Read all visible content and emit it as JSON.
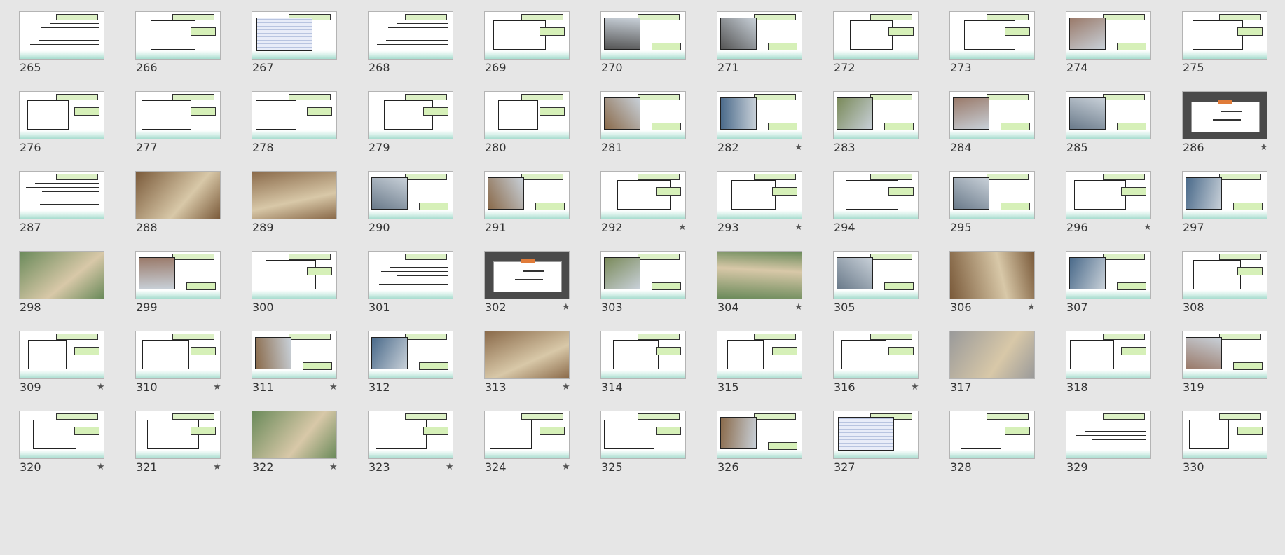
{
  "grid": {
    "columns": 11,
    "slides": [
      {
        "number": "265",
        "starred": false,
        "kind": "text"
      },
      {
        "number": "266",
        "starred": false,
        "kind": "diagram"
      },
      {
        "number": "267",
        "starred": false,
        "kind": "table"
      },
      {
        "number": "268",
        "starred": false,
        "kind": "text"
      },
      {
        "number": "269",
        "starred": false,
        "kind": "diagram"
      },
      {
        "number": "270",
        "starred": false,
        "kind": "photo-grey"
      },
      {
        "number": "271",
        "starred": false,
        "kind": "photo-grey"
      },
      {
        "number": "272",
        "starred": false,
        "kind": "diagram"
      },
      {
        "number": "273",
        "starred": false,
        "kind": "diagram"
      },
      {
        "number": "274",
        "starred": false,
        "kind": "photo"
      },
      {
        "number": "275",
        "starred": false,
        "kind": "diagram"
      },
      {
        "number": "276",
        "starred": false,
        "kind": "diagram"
      },
      {
        "number": "277",
        "starred": false,
        "kind": "diagram"
      },
      {
        "number": "278",
        "starred": false,
        "kind": "diagram"
      },
      {
        "number": "279",
        "starred": false,
        "kind": "diagram"
      },
      {
        "number": "280",
        "starred": false,
        "kind": "diagram"
      },
      {
        "number": "281",
        "starred": false,
        "kind": "photo"
      },
      {
        "number": "282",
        "starred": true,
        "kind": "photo"
      },
      {
        "number": "283",
        "starred": false,
        "kind": "photo"
      },
      {
        "number": "284",
        "starred": false,
        "kind": "photo"
      },
      {
        "number": "285",
        "starred": false,
        "kind": "photo"
      },
      {
        "number": "286",
        "starred": true,
        "kind": "title"
      },
      {
        "number": "287",
        "starred": false,
        "kind": "text"
      },
      {
        "number": "288",
        "starred": false,
        "kind": "photo-full"
      },
      {
        "number": "289",
        "starred": false,
        "kind": "photo-full"
      },
      {
        "number": "290",
        "starred": false,
        "kind": "photo"
      },
      {
        "number": "291",
        "starred": false,
        "kind": "photo"
      },
      {
        "number": "292",
        "starred": true,
        "kind": "diagram"
      },
      {
        "number": "293",
        "starred": true,
        "kind": "diagram"
      },
      {
        "number": "294",
        "starred": false,
        "kind": "diagram"
      },
      {
        "number": "295",
        "starred": false,
        "kind": "photo"
      },
      {
        "number": "296",
        "starred": true,
        "kind": "diagram"
      },
      {
        "number": "297",
        "starred": false,
        "kind": "photo"
      },
      {
        "number": "298",
        "starred": false,
        "kind": "photo-full"
      },
      {
        "number": "299",
        "starred": false,
        "kind": "photo"
      },
      {
        "number": "300",
        "starred": false,
        "kind": "diagram"
      },
      {
        "number": "301",
        "starred": false,
        "kind": "text"
      },
      {
        "number": "302",
        "starred": true,
        "kind": "title"
      },
      {
        "number": "303",
        "starred": false,
        "kind": "photo"
      },
      {
        "number": "304",
        "starred": true,
        "kind": "photo-full"
      },
      {
        "number": "305",
        "starred": false,
        "kind": "photo"
      },
      {
        "number": "306",
        "starred": true,
        "kind": "photo-full"
      },
      {
        "number": "307",
        "starred": false,
        "kind": "photo"
      },
      {
        "number": "308",
        "starred": false,
        "kind": "diagram"
      },
      {
        "number": "309",
        "starred": true,
        "kind": "diagram"
      },
      {
        "number": "310",
        "starred": true,
        "kind": "diagram"
      },
      {
        "number": "311",
        "starred": true,
        "kind": "photo"
      },
      {
        "number": "312",
        "starred": false,
        "kind": "photo"
      },
      {
        "number": "313",
        "starred": true,
        "kind": "photo-full"
      },
      {
        "number": "314",
        "starred": false,
        "kind": "diagram"
      },
      {
        "number": "315",
        "starred": false,
        "kind": "diagram"
      },
      {
        "number": "316",
        "starred": true,
        "kind": "diagram"
      },
      {
        "number": "317",
        "starred": false,
        "kind": "photo-full"
      },
      {
        "number": "318",
        "starred": false,
        "kind": "diagram"
      },
      {
        "number": "319",
        "starred": false,
        "kind": "photo"
      },
      {
        "number": "320",
        "starred": true,
        "kind": "diagram"
      },
      {
        "number": "321",
        "starred": true,
        "kind": "diagram"
      },
      {
        "number": "322",
        "starred": true,
        "kind": "photo-full"
      },
      {
        "number": "323",
        "starred": true,
        "kind": "diagram"
      },
      {
        "number": "324",
        "starred": true,
        "kind": "diagram"
      },
      {
        "number": "325",
        "starred": false,
        "kind": "diagram"
      },
      {
        "number": "326",
        "starred": false,
        "kind": "photo"
      },
      {
        "number": "327",
        "starred": false,
        "kind": "table"
      },
      {
        "number": "328",
        "starred": false,
        "kind": "diagram"
      },
      {
        "number": "329",
        "starred": false,
        "kind": "text"
      },
      {
        "number": "330",
        "starred": false,
        "kind": "diagram"
      }
    ]
  },
  "icons": {
    "star": "star-icon"
  },
  "colors": {
    "background": "#e6e6e6",
    "number_text": "#333333",
    "header_green": "#dcf0c5",
    "title_slide_dark": "#4a4a4a",
    "title_slide_accent": "#e07b39"
  }
}
